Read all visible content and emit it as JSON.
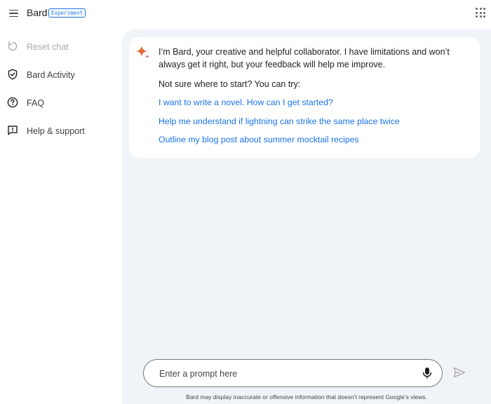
{
  "header": {
    "title": "Bard",
    "badge": "Experiment",
    "menu_icon": "hamburger-menu-icon",
    "apps_icon": "apps-grid-icon"
  },
  "sidebar": {
    "items": [
      {
        "label": "Reset chat",
        "icon": "reset-icon",
        "disabled": true
      },
      {
        "label": "Bard Activity",
        "icon": "shield-icon",
        "disabled": false
      },
      {
        "label": "FAQ",
        "icon": "help-circle-icon",
        "disabled": false
      },
      {
        "label": "Help & support",
        "icon": "feedback-icon",
        "disabled": false
      }
    ]
  },
  "chat": {
    "assistant_icon": "sparkle-icon",
    "intro": "I’m Bard, your creative and helpful collaborator. I have limitations and won’t always get it right, but your feedback will help me improve.",
    "try_label": "Not sure where to start? You can try:",
    "suggestions": [
      "I want to write a novel. How can I get started?",
      "Help me understand if lightning can strike the same place twice",
      "Outline my blog post about summer mocktail recipes"
    ]
  },
  "input": {
    "placeholder": "Enter a prompt here",
    "value": "",
    "mic_icon": "microphone-icon",
    "send_icon": "send-icon"
  },
  "footer": {
    "disclaimer": "Bard may display inaccurate or offensive information that doesn’t represent Google’s views."
  },
  "colors": {
    "accent": "#1a73e8",
    "main_bg": "#f0f4f9",
    "sparkle_orange": "#e37400",
    "sparkle_red": "#d96570"
  }
}
